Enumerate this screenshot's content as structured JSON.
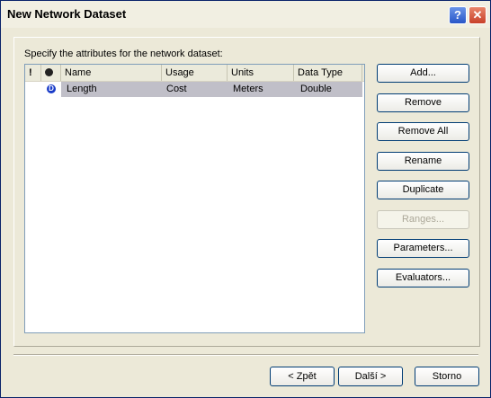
{
  "window": {
    "title": "New Network Dataset",
    "help_glyph": "?",
    "close_glyph": "✕"
  },
  "instruction": "Specify the attributes for the network dataset:",
  "list": {
    "columns": [
      "!",
      "",
      "Name",
      "Usage",
      "Units",
      "Data Type"
    ],
    "rows": [
      {
        "name": "Length",
        "usage": "Cost",
        "units": "Meters",
        "type": "Double",
        "icon": "default-attribute-icon"
      }
    ]
  },
  "buttons": {
    "add": "Add...",
    "remove": "Remove",
    "remove_all": "Remove All",
    "rename": "Rename",
    "duplicate": "Duplicate",
    "ranges": "Ranges...",
    "parameters": "Parameters...",
    "evaluators": "Evaluators..."
  },
  "footer": {
    "back": "< Zpět",
    "next": "Další >",
    "cancel": "Storno"
  }
}
